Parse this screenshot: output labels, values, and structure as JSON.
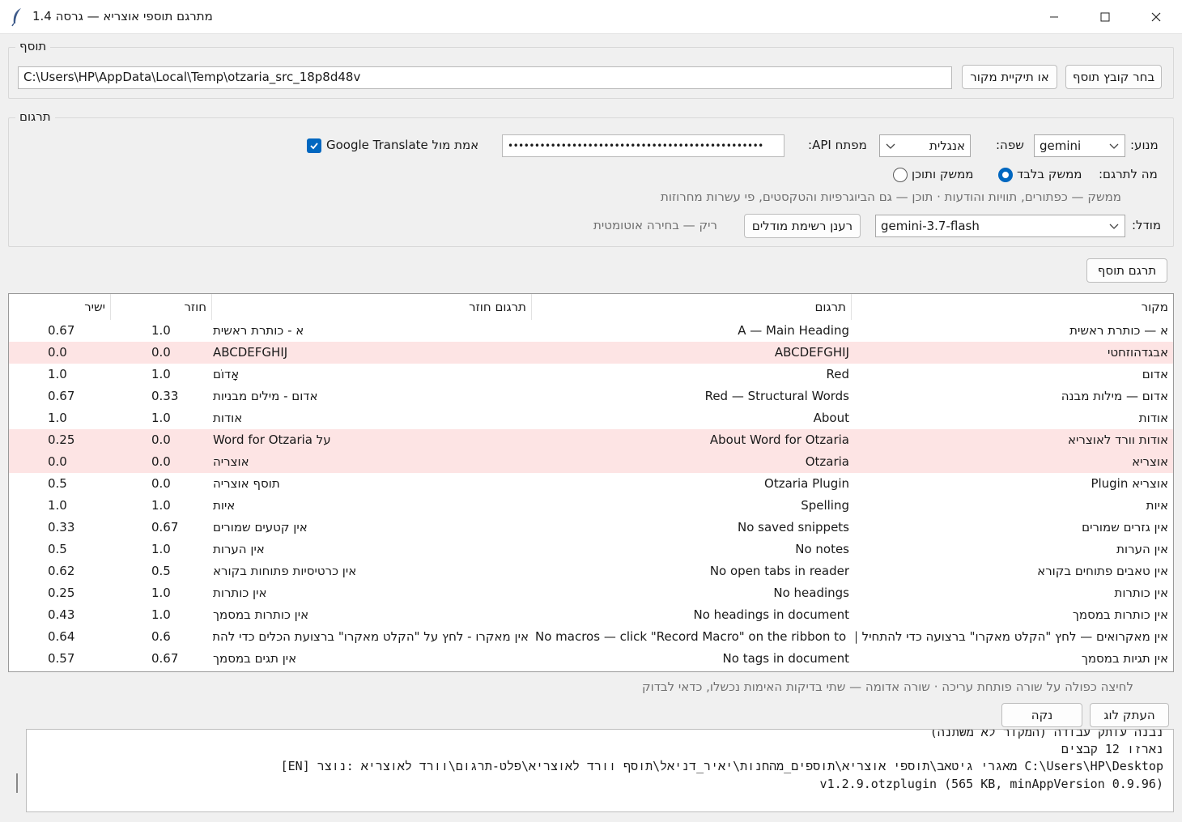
{
  "window": {
    "title": "מתרגם תוספי אוצריא — גרסה 1.4",
    "app_icon": "feather-icon"
  },
  "plugin_section": {
    "legend": "תוסף",
    "path_value": "C:\\Users\\HP\\AppData\\Local\\Temp\\otzaria_src_18p8d48v",
    "choose_file_button": "בחר קובץ תוסף",
    "or_folder_button": "או תיקיית מקור"
  },
  "translate_section": {
    "legend": "תרגום",
    "engine_label": "מנוע:",
    "engine_value": "gemini",
    "language_label": "שפה:",
    "language_value": "אנגלית",
    "api_key_label": "מפתח API:",
    "api_key_value": "••••••••••••••••••••••••••••••••••••••••••••••••",
    "verify_checkbox_label": "אמת מול Google Translate",
    "verify_checked": true,
    "what_label": "מה לתרגם:",
    "option_ui_only": "ממשק בלבד",
    "option_ui_and_content": "ממשק ותוכן",
    "selected_option": "ui_only",
    "hint": "ממשק — כפתורים, תוויות והודעות · תוכן — גם הביוגרפיות והטקסטים, פי עשרות מחרוזות",
    "model_label": "מודל:",
    "model_value": "gemini-3.7-flash",
    "refresh_models_button": "רענן רשימת מודלים",
    "empty_auto_hint": "ריק — בחירה אוטומטית"
  },
  "translate_plugin_button": "תרגם תוסף",
  "table": {
    "headers": {
      "source": "מקור",
      "translation": "תרגום",
      "back_translation": "תרגום חוזר",
      "back_score": "חוזר",
      "direct_score": "ישיר"
    },
    "rows": [
      {
        "source": "א — כותרת ראשית",
        "translation": "A — Main Heading",
        "back": "א - כותרת ראשית",
        "back_score": "1.0",
        "direct": "0.67",
        "fail": false
      },
      {
        "source": "אבגדהוזחטי",
        "translation": "ABCDEFGHIJ",
        "back": "ABCDEFGHIJ",
        "back_score": "0.0",
        "direct": "0.0",
        "fail": true
      },
      {
        "source": "אדום",
        "translation": "Red",
        "back": "אָדוֹם",
        "back_score": "1.0",
        "direct": "1.0",
        "fail": false
      },
      {
        "source": "אדום — מילות מבנה",
        "translation": "Red — Structural Words",
        "back": "אדום - מילים מבניות",
        "back_score": "0.33",
        "direct": "0.67",
        "fail": false
      },
      {
        "source": "אודות",
        "translation": "About",
        "back": "אודות",
        "back_score": "1.0",
        "direct": "1.0",
        "fail": false
      },
      {
        "source": "אודות וורד לאוצריא",
        "translation": "About Word for Otzaria",
        "back": "על Word for Otzaria",
        "back_score": "0.0",
        "direct": "0.25",
        "fail": true
      },
      {
        "source": "אוצריא",
        "translation": "Otzaria",
        "back": "אוצריה",
        "back_score": "0.0",
        "direct": "0.0",
        "fail": true
      },
      {
        "source": "אוצריא Plugin",
        "translation": "Otzaria Plugin",
        "back": "תוסף אוצריה",
        "back_score": "0.0",
        "direct": "0.5",
        "fail": false
      },
      {
        "source": "איות",
        "translation": "Spelling",
        "back": "איות",
        "back_score": "1.0",
        "direct": "1.0",
        "fail": false
      },
      {
        "source": "אין גזרים שמורים",
        "translation": "No saved snippets",
        "back": "אין קטעים שמורים",
        "back_score": "0.67",
        "direct": "0.33",
        "fail": false
      },
      {
        "source": "אין הערות",
        "translation": "No notes",
        "back": "אין הערות",
        "back_score": "1.0",
        "direct": "0.5",
        "fail": false
      },
      {
        "source": "אין טאבים פתוחים בקורא",
        "translation": "No open tabs in reader",
        "back": "אין כרטיסיות פתוחות בקורא",
        "back_score": "0.5",
        "direct": "0.62",
        "fail": false
      },
      {
        "source": "אין כותרות",
        "translation": "No headings",
        "back": "אין כותרות",
        "back_score": "1.0",
        "direct": "0.25",
        "fail": false
      },
      {
        "source": "אין כותרות במסמך",
        "translation": "No headings in document",
        "back": "אין כותרות במסמך",
        "back_score": "1.0",
        "direct": "0.43",
        "fail": false
      },
      {
        "source": "אין מאקרואים — לחץ \"הקלט מאקרו\" ברצועה כדי להתחיל |",
        "translation": "No macros — click \"Record Macro\" on the ribbon to s",
        "back": "אין מאקרו - לחץ על \"הקלט מאקרו\" ברצועת הכלים כדי להתחיל",
        "back_score": "0.6",
        "direct": "0.64",
        "fail": false
      },
      {
        "source": "אין תגיות במסמך",
        "translation": "No tags in document",
        "back": "אין תגים במסמך",
        "back_score": "0.67",
        "direct": "0.57",
        "fail": false
      }
    ]
  },
  "table_hint": "לחיצה כפולה על שורה פותחת עריכה · שורה אדומה — שתי בדיקות האימות נכשלו, כדאי לבדוק",
  "copy_log_button": "העתק לוג",
  "clear_button": "נקה",
  "log": {
    "lines": [
      "נבנה עותק עבודה (המקור לא משתנה)",
      "נארזו 12 קבצים",
      "[EN] מאגרי גיטאב\\תוספי אוצריא\\תוספים_מהחנות\\יאיר_דניאל\\תוסף וורד לאוצריא\\פלט-תרגום\\וורד לאוצריא :נוצר C:\\Users\\HP\\Desktop",
      "v1.2.9.otzplugin  (565 KB, minAppVersion 0.9.96)"
    ]
  }
}
